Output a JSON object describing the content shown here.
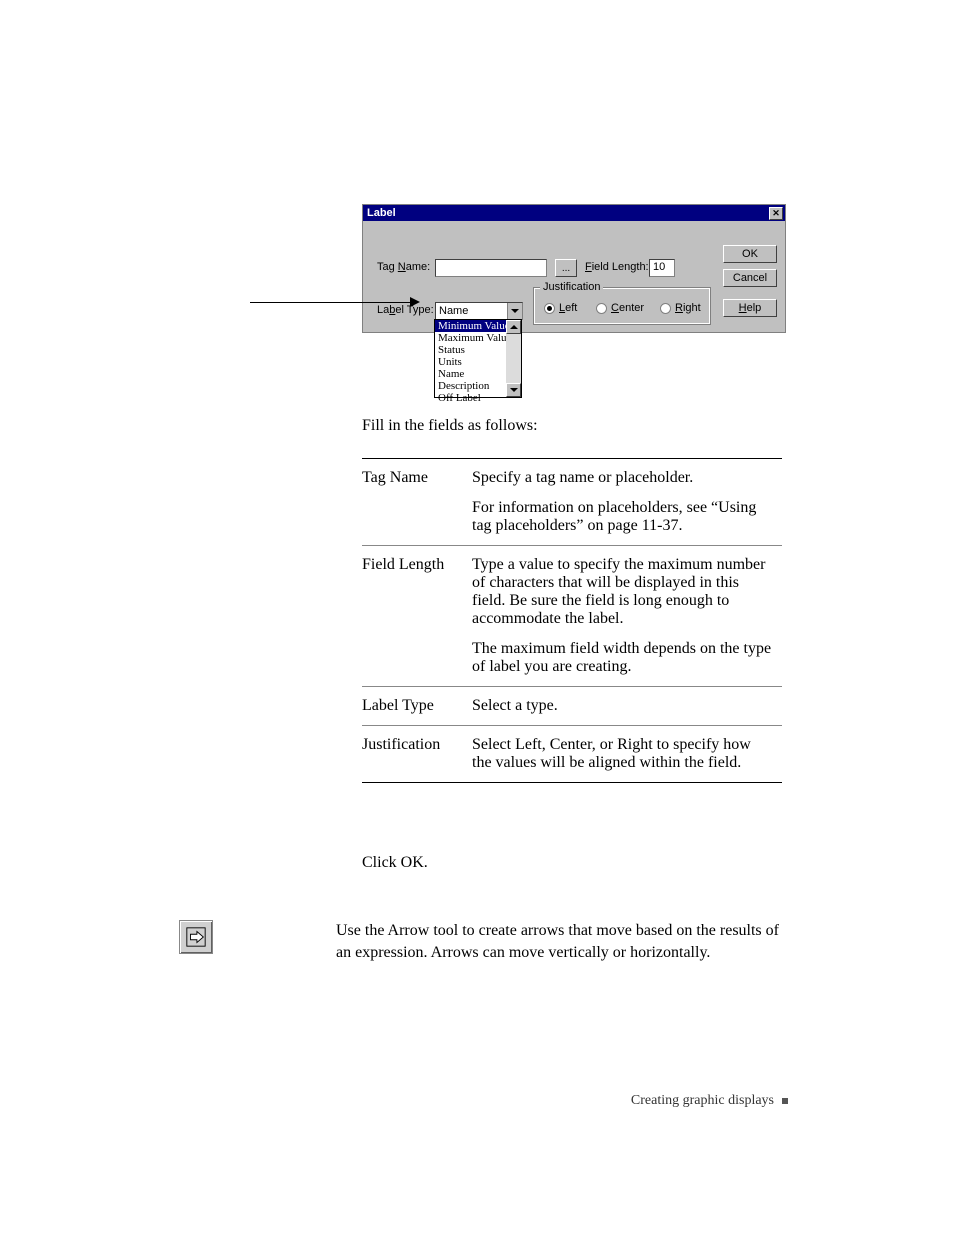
{
  "dialog": {
    "title": "Label",
    "tag_name_label": "Tag Name:",
    "tag_name_value": "",
    "browse_label": "...",
    "field_length_label": "Field Length:",
    "field_length_value": "10",
    "label_type_label": "Label Type:",
    "label_type_value": "Name",
    "label_type_options": {
      "o0": "Minimum Value",
      "o1": "Maximum Value",
      "o2": "Status",
      "o3": "Units",
      "o4": "Name",
      "o5": "Description",
      "o6": "Off Label"
    },
    "justification": {
      "legend": "Justification",
      "left": "Left",
      "center": "Center",
      "right": "Right"
    },
    "buttons": {
      "ok": "OK",
      "cancel": "Cancel",
      "help": "Help"
    }
  },
  "intro": "Fill in the fields as follows:",
  "table": {
    "r0": {
      "name": "Tag Name",
      "p1": "Specify a tag name or placeholder.",
      "p2": "For information on placeholders, see “Using tag placeholders” on page 11-37."
    },
    "r1": {
      "name": "Field Length",
      "p1": "Type a value to specify the maximum number of characters that will be displayed in this field. Be sure the field is long enough to accommodate the label.",
      "p2": "The maximum field width depends on the type of label you are creating."
    },
    "r2": {
      "name": "Label Type",
      "p1": "Select a type."
    },
    "r3": {
      "name": "Justification",
      "p1": "Select Left, Center, or Right to specify how the values will be aligned within the field."
    }
  },
  "click_ok": "Click OK.",
  "arrow_text": "Use the Arrow tool to create arrows that move based on the results of an expression. Arrows can move vertically or horizontally.",
  "footer": "Creating graphic displays"
}
